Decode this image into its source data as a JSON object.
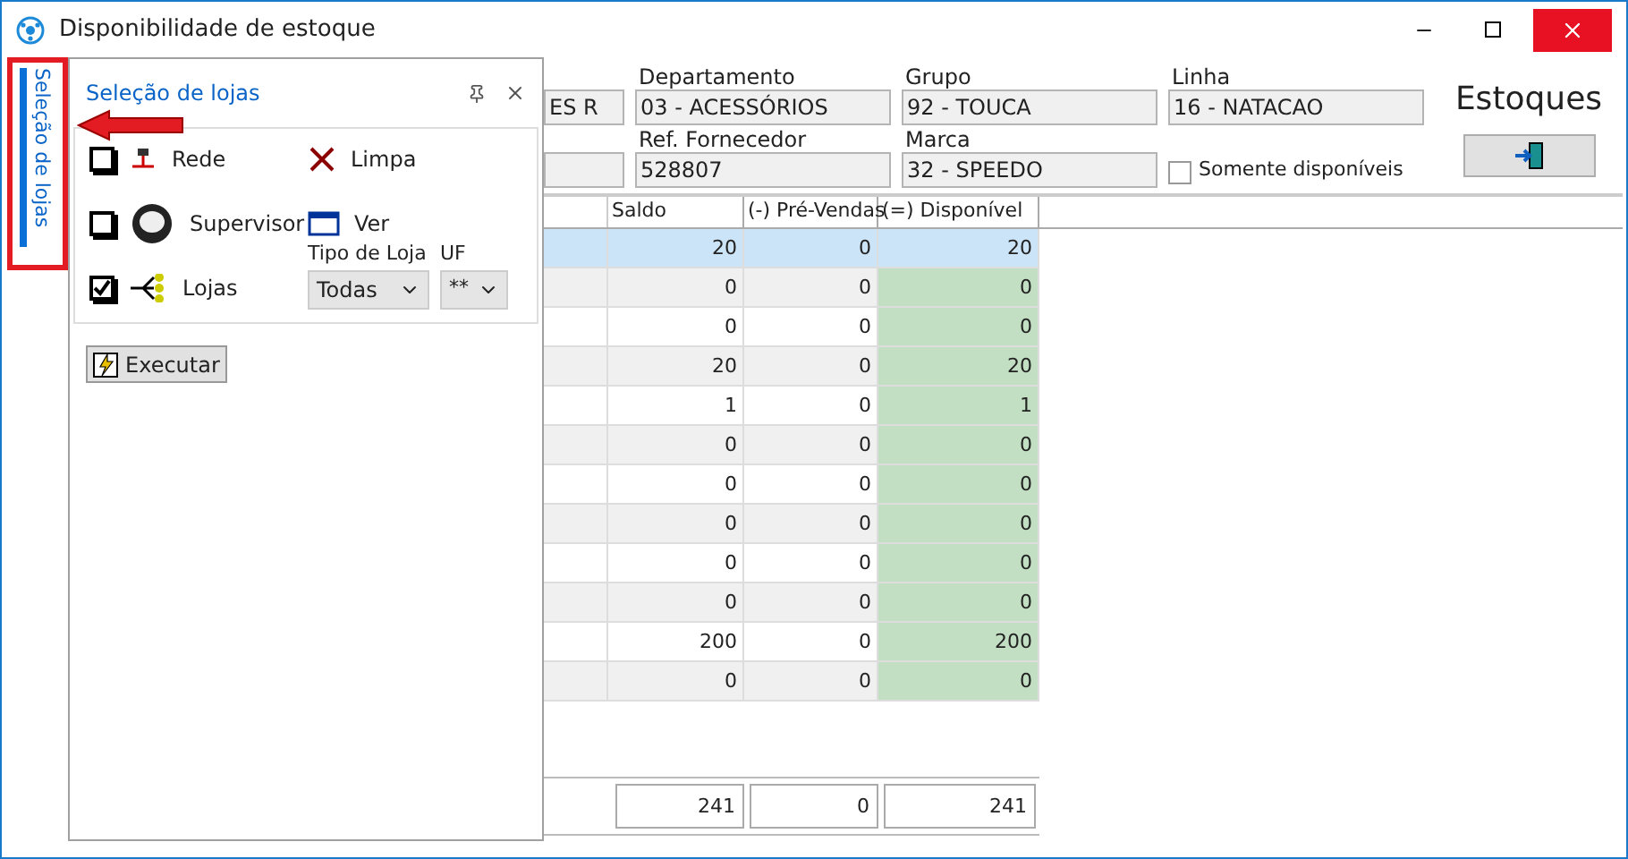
{
  "window": {
    "title": "Disponibilidade de estoque"
  },
  "side_tab": {
    "label": "Seleção de lojas",
    "selected": true
  },
  "panel": {
    "title": "Seleção de lojas",
    "options": [
      {
        "kind": "check",
        "label": "Rede",
        "checked": false
      },
      {
        "kind": "action",
        "label": "Limpa"
      },
      {
        "kind": "check",
        "label": "Supervisor",
        "checked": false
      },
      {
        "kind": "action",
        "label": "Ver"
      },
      {
        "kind": "check",
        "label": "Lojas",
        "checked": true
      }
    ],
    "tipo_de_loja": {
      "label": "Tipo de Loja",
      "value": "Todas"
    },
    "uf": {
      "label": "UF",
      "value": "**"
    },
    "execute_button": "Executar"
  },
  "filters": [
    {
      "kind": "field",
      "value": "ES R"
    },
    {
      "kind": "field",
      "label": "Departamento",
      "value": "03 - ACESSÓRIOS"
    },
    {
      "kind": "field",
      "label": "Grupo",
      "value": "92 - TOUCA"
    },
    {
      "kind": "field",
      "label": "Linha",
      "value": "16 - NATACAO"
    },
    {
      "kind": "empty_field"
    },
    {
      "kind": "field",
      "label": "Ref. Fornecedor",
      "value": "528807"
    },
    {
      "kind": "field",
      "label": "Marca",
      "value": "32 - SPEEDO"
    }
  ],
  "only_available": {
    "label": "Somente disponíveis",
    "checked": false
  },
  "heading": "Estoques",
  "table": {
    "columns": [
      "Saldo",
      "(-) Pré-Vendas",
      "(=) Disponível"
    ],
    "rows": [
      {
        "cells": [
          "20",
          "0",
          "20"
        ],
        "selected": true
      },
      {
        "cells": [
          "0",
          "0",
          "0"
        ],
        "selected": false
      },
      {
        "cells": [
          "0",
          "0",
          "0"
        ],
        "selected": false
      },
      {
        "cells": [
          "20",
          "0",
          "20"
        ],
        "selected": false
      },
      {
        "cells": [
          "1",
          "0",
          "1"
        ],
        "selected": false
      },
      {
        "cells": [
          "0",
          "0",
          "0"
        ],
        "selected": false
      },
      {
        "cells": [
          "0",
          "0",
          "0"
        ],
        "selected": false
      },
      {
        "cells": [
          "0",
          "0",
          "0"
        ],
        "selected": false
      },
      {
        "cells": [
          "0",
          "0",
          "0"
        ],
        "selected": false
      },
      {
        "cells": [
          "0",
          "0",
          "0"
        ],
        "selected": false
      },
      {
        "cells": [
          "200",
          "0",
          "200"
        ],
        "selected": false
      },
      {
        "cells": [
          "0",
          "0",
          "0"
        ],
        "selected": false
      }
    ],
    "totals": [
      "241",
      "0",
      "241"
    ]
  }
}
